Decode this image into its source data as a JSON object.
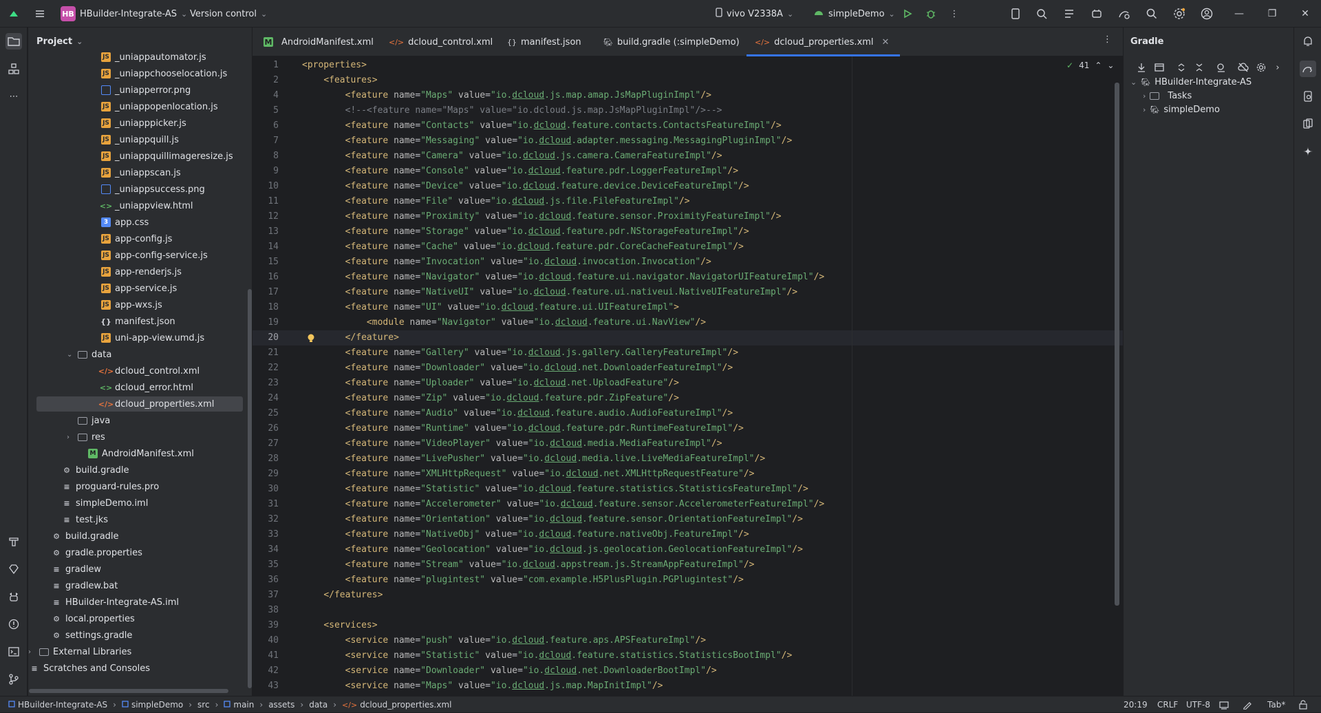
{
  "titlebar": {
    "project_badge": "HB",
    "project_name": "HBuilder-Integrate-AS",
    "vcs": "Version control",
    "device": "vivo V2338A",
    "run_config": "simpleDemo"
  },
  "sidebar": {
    "title": "Project"
  },
  "tree": [
    {
      "label": "_uniappautomator.js",
      "icon": "js"
    },
    {
      "label": "_uniappchooselocation.js",
      "icon": "js"
    },
    {
      "label": "_uniapperror.png",
      "icon": "img"
    },
    {
      "label": "_uniappopenlocation.js",
      "icon": "js"
    },
    {
      "label": "_uniapppicker.js",
      "icon": "js"
    },
    {
      "label": "_uniappquill.js",
      "icon": "js"
    },
    {
      "label": "_uniappquillimageresize.js",
      "icon": "js"
    },
    {
      "label": "_uniappscan.js",
      "icon": "js"
    },
    {
      "label": "_uniappsuccess.png",
      "icon": "img"
    },
    {
      "label": "_uniappview.html",
      "icon": "html"
    },
    {
      "label": "app.css",
      "icon": "css"
    },
    {
      "label": "app-config.js",
      "icon": "js"
    },
    {
      "label": "app-config-service.js",
      "icon": "js"
    },
    {
      "label": "app-renderjs.js",
      "icon": "js"
    },
    {
      "label": "app-service.js",
      "icon": "js"
    },
    {
      "label": "app-wxs.js",
      "icon": "js"
    },
    {
      "label": "manifest.json",
      "icon": "json"
    },
    {
      "label": "uni-app-view.umd.js",
      "icon": "js"
    },
    {
      "label": "data",
      "icon": "folder"
    },
    {
      "label": "dcloud_control.xml",
      "icon": "xml"
    },
    {
      "label": "dcloud_error.html",
      "icon": "html"
    },
    {
      "label": "dcloud_properties.xml",
      "icon": "xml"
    },
    {
      "label": "java",
      "icon": "folder"
    },
    {
      "label": "res",
      "icon": "folder"
    },
    {
      "label": "AndroidManifest.xml",
      "icon": "manifest"
    },
    {
      "label": "build.gradle",
      "icon": "gradle"
    },
    {
      "label": "proguard-rules.pro",
      "icon": "text"
    },
    {
      "label": "simpleDemo.iml",
      "icon": "text"
    },
    {
      "label": "test.jks",
      "icon": "text"
    },
    {
      "label": "build.gradle",
      "icon": "gradle"
    },
    {
      "label": "gradle.properties",
      "icon": "gradle"
    },
    {
      "label": "gradlew",
      "icon": "text"
    },
    {
      "label": "gradlew.bat",
      "icon": "text"
    },
    {
      "label": "HBuilder-Integrate-AS.iml",
      "icon": "text"
    },
    {
      "label": "local.properties",
      "icon": "gradle"
    },
    {
      "label": "settings.gradle",
      "icon": "gradle"
    },
    {
      "label": "External Libraries",
      "icon": "folder"
    },
    {
      "label": "Scratches and Consoles",
      "icon": "text"
    }
  ],
  "tabs": [
    {
      "label": "AndroidManifest.xml"
    },
    {
      "label": "dcloud_control.xml"
    },
    {
      "label": "manifest.json"
    },
    {
      "label": "build.gradle (:simpleDemo)"
    },
    {
      "label": "dcloud_properties.xml"
    }
  ],
  "editor": {
    "inspection_count": "41",
    "lines": [
      {
        "n": "1",
        "text": "<properties>"
      },
      {
        "n": "2",
        "text": "    <features>"
      },
      {
        "n": "4",
        "text": "        <feature name=\"Maps\" value=\"io.dcloud.js.map.amap.JsMapPluginImpl\"/>"
      },
      {
        "n": "5",
        "text": "        <!--<feature name=\"Maps\" value=\"io.dcloud.js.map.JsMapPluginImpl\"/>-->"
      },
      {
        "n": "6",
        "text": "        <feature name=\"Contacts\" value=\"io.dcloud.feature.contacts.ContactsFeatureImpl\"/>"
      },
      {
        "n": "7",
        "text": "        <feature name=\"Messaging\" value=\"io.dcloud.adapter.messaging.MessagingPluginImpl\"/>"
      },
      {
        "n": "8",
        "text": "        <feature name=\"Camera\" value=\"io.dcloud.js.camera.CameraFeatureImpl\"/>"
      },
      {
        "n": "9",
        "text": "        <feature name=\"Console\" value=\"io.dcloud.feature.pdr.LoggerFeatureImpl\"/>"
      },
      {
        "n": "10",
        "text": "        <feature name=\"Device\" value=\"io.dcloud.feature.device.DeviceFeatureImpl\"/>"
      },
      {
        "n": "11",
        "text": "        <feature name=\"File\" value=\"io.dcloud.js.file.FileFeatureImpl\"/>"
      },
      {
        "n": "12",
        "text": "        <feature name=\"Proximity\" value=\"io.dcloud.feature.sensor.ProximityFeatureImpl\"/>"
      },
      {
        "n": "13",
        "text": "        <feature name=\"Storage\" value=\"io.dcloud.feature.pdr.NStorageFeatureImpl\"/>"
      },
      {
        "n": "14",
        "text": "        <feature name=\"Cache\" value=\"io.dcloud.feature.pdr.CoreCacheFeatureImpl\"/>"
      },
      {
        "n": "15",
        "text": "        <feature name=\"Invocation\" value=\"io.dcloud.invocation.Invocation\"/>"
      },
      {
        "n": "16",
        "text": "        <feature name=\"Navigator\" value=\"io.dcloud.feature.ui.navigator.NavigatorUIFeatureImpl\"/>"
      },
      {
        "n": "17",
        "text": "        <feature name=\"NativeUI\" value=\"io.dcloud.feature.ui.nativeui.NativeUIFeatureImpl\"/>"
      },
      {
        "n": "18",
        "text": "        <feature name=\"UI\" value=\"io.dcloud.feature.ui.UIFeatureImpl\">"
      },
      {
        "n": "19",
        "text": "            <module name=\"Navigator\" value=\"io.dcloud.feature.ui.NavView\"/>"
      },
      {
        "n": "20",
        "text": "        </feature>"
      },
      {
        "n": "21",
        "text": "        <feature name=\"Gallery\" value=\"io.dcloud.js.gallery.GalleryFeatureImpl\"/>"
      },
      {
        "n": "22",
        "text": "        <feature name=\"Downloader\" value=\"io.dcloud.net.DownloaderFeatureImpl\"/>"
      },
      {
        "n": "23",
        "text": "        <feature name=\"Uploader\" value=\"io.dcloud.net.UploadFeature\"/>"
      },
      {
        "n": "24",
        "text": "        <feature name=\"Zip\" value=\"io.dcloud.feature.pdr.ZipFeature\"/>"
      },
      {
        "n": "25",
        "text": "        <feature name=\"Audio\" value=\"io.dcloud.feature.audio.AudioFeatureImpl\"/>"
      },
      {
        "n": "26",
        "text": "        <feature name=\"Runtime\" value=\"io.dcloud.feature.pdr.RuntimeFeatureImpl\"/>"
      },
      {
        "n": "27",
        "text": "        <feature name=\"VideoPlayer\" value=\"io.dcloud.media.MediaFeatureImpl\"/>"
      },
      {
        "n": "28",
        "text": "        <feature name=\"LivePusher\" value=\"io.dcloud.media.live.LiveMediaFeatureImpl\"/>"
      },
      {
        "n": "29",
        "text": "        <feature name=\"XMLHttpRequest\" value=\"io.dcloud.net.XMLHttpRequestFeature\"/>"
      },
      {
        "n": "30",
        "text": "        <feature name=\"Statistic\" value=\"io.dcloud.feature.statistics.StatisticsFeatureImpl\"/>"
      },
      {
        "n": "31",
        "text": "        <feature name=\"Accelerometer\" value=\"io.dcloud.feature.sensor.AccelerometerFeatureImpl\"/>"
      },
      {
        "n": "32",
        "text": "        <feature name=\"Orientation\" value=\"io.dcloud.feature.sensor.OrientationFeatureImpl\"/>"
      },
      {
        "n": "33",
        "text": "        <feature name=\"NativeObj\" value=\"io.dcloud.feature.nativeObj.FeatureImpl\"/>"
      },
      {
        "n": "34",
        "text": "        <feature name=\"Geolocation\" value=\"io.dcloud.js.geolocation.GeolocationFeatureImpl\"/>"
      },
      {
        "n": "35",
        "text": "        <feature name=\"Stream\" value=\"io.dcloud.appstream.js.StreamAppFeatureImpl\"/>"
      },
      {
        "n": "36",
        "text": "        <feature name=\"plugintest\" value=\"com.example.H5PlusPlugin.PGPlugintest\"/>"
      },
      {
        "n": "37",
        "text": "    </features>"
      },
      {
        "n": "38",
        "text": ""
      },
      {
        "n": "39",
        "text": "    <services>"
      },
      {
        "n": "40",
        "text": "        <service name=\"push\" value=\"io.dcloud.feature.aps.APSFeatureImpl\"/>"
      },
      {
        "n": "41",
        "text": "        <service name=\"Statistic\" value=\"io.dcloud.feature.statistics.StatisticsBootImpl\"/>"
      },
      {
        "n": "42",
        "text": "        <service name=\"Downloader\" value=\"io.dcloud.net.DownloaderBootImpl\"/>"
      },
      {
        "n": "43",
        "text": "        <service name=\"Maps\" value=\"io.dcloud.js.map.MapInitImpl\"/>"
      }
    ]
  },
  "gradle": {
    "title": "Gradle",
    "root": "HBuilder-Integrate-AS",
    "children": [
      "Tasks",
      "simpleDemo"
    ]
  },
  "statusbar": {
    "breadcrumbs": [
      "HBuilder-Integrate-AS",
      "simpleDemo",
      "src",
      "main",
      "assets",
      "data",
      "dcloud_properties.xml"
    ],
    "position": "20:19",
    "line_sep": "CRLF",
    "encoding": "UTF-8",
    "indent": "Tab*"
  },
  "colors": {
    "accent": "#3574f0",
    "tag": "#d5b778",
    "string": "#6aab73",
    "badge": "#c54fa9"
  }
}
